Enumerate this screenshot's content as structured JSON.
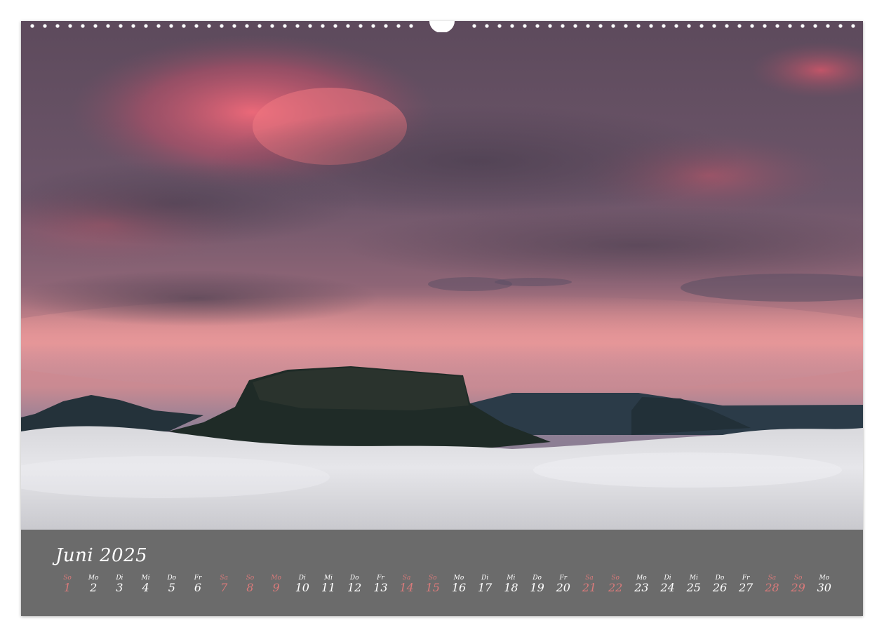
{
  "calendar": {
    "month_title": "Juni 2025",
    "days": [
      {
        "weekday": "So",
        "day": "1",
        "weekend": true
      },
      {
        "weekday": "Mo",
        "day": "2",
        "weekend": false
      },
      {
        "weekday": "Di",
        "day": "3",
        "weekend": false
      },
      {
        "weekday": "Mi",
        "day": "4",
        "weekend": false
      },
      {
        "weekday": "Do",
        "day": "5",
        "weekend": false
      },
      {
        "weekday": "Fr",
        "day": "6",
        "weekend": false
      },
      {
        "weekday": "Sa",
        "day": "7",
        "weekend": true
      },
      {
        "weekday": "So",
        "day": "8",
        "weekend": true
      },
      {
        "weekday": "Mo",
        "day": "9",
        "weekend": true
      },
      {
        "weekday": "Di",
        "day": "10",
        "weekend": false
      },
      {
        "weekday": "Mi",
        "day": "11",
        "weekend": false
      },
      {
        "weekday": "Do",
        "day": "12",
        "weekend": false
      },
      {
        "weekday": "Fr",
        "day": "13",
        "weekend": false
      },
      {
        "weekday": "Sa",
        "day": "14",
        "weekend": true
      },
      {
        "weekday": "So",
        "day": "15",
        "weekend": true
      },
      {
        "weekday": "Mo",
        "day": "16",
        "weekend": false
      },
      {
        "weekday": "Di",
        "day": "17",
        "weekend": false
      },
      {
        "weekday": "Mi",
        "day": "18",
        "weekend": false
      },
      {
        "weekday": "Do",
        "day": "19",
        "weekend": false
      },
      {
        "weekday": "Fr",
        "day": "20",
        "weekend": false
      },
      {
        "weekday": "Sa",
        "day": "21",
        "weekend": true
      },
      {
        "weekday": "So",
        "day": "22",
        "weekend": true
      },
      {
        "weekday": "Mo",
        "day": "23",
        "weekend": false
      },
      {
        "weekday": "Di",
        "day": "24",
        "weekend": false
      },
      {
        "weekday": "Mi",
        "day": "25",
        "weekend": false
      },
      {
        "weekday": "Do",
        "day": "26",
        "weekend": false
      },
      {
        "weekday": "Fr",
        "day": "27",
        "weekend": false
      },
      {
        "weekday": "Sa",
        "day": "28",
        "weekend": true
      },
      {
        "weekday": "So",
        "day": "29",
        "weekend": true
      },
      {
        "weekday": "Mo",
        "day": "30",
        "weekend": false
      }
    ]
  },
  "colors": {
    "bar_background": "#6b6b6b",
    "weekday_text": "#ffffff",
    "weekend_text": "#d97a7a"
  }
}
